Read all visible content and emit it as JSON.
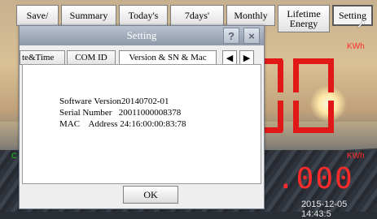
{
  "toolbar": {
    "tabs": [
      {
        "label": "Save/"
      },
      {
        "label": "Summary"
      },
      {
        "label": "Today's"
      },
      {
        "label": "7days'"
      },
      {
        "label": "Monthly"
      },
      {
        "label": "Lifetime Energy"
      },
      {
        "label": "Setting"
      }
    ]
  },
  "display": {
    "unit_top": "KWh",
    "unit_bottom": "KWh",
    "value_bottom": ".000",
    "timestamp": "2015-12-05 14:43:5",
    "left_marker": "C"
  },
  "dialog": {
    "title": "Setting",
    "help_label": "?",
    "close_label": "×",
    "tabs": [
      {
        "label": "te&Time"
      },
      {
        "label": "COM ID"
      },
      {
        "label": "Version & SN & Mac"
      }
    ],
    "arrow_left": "◀",
    "arrow_right": "▶",
    "info": [
      {
        "label": "Software Version",
        "value": "20140702-01"
      },
      {
        "label": "Serial Number   ",
        "value": "20011000008378"
      },
      {
        "label": "MAC    Address",
        "value": "24:16:00:00:83:78"
      }
    ],
    "ok_label": "OK"
  },
  "colors": {
    "digit_red": "#e11818",
    "titlebar": "#9aa5b5"
  }
}
